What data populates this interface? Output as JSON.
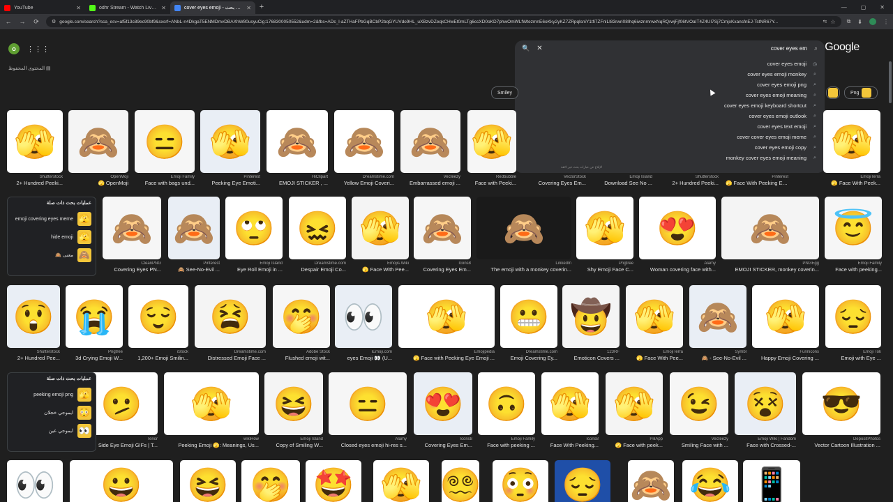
{
  "browser": {
    "tabs": [
      {
        "title": "YouTube",
        "color": "#ff0000"
      },
      {
        "title": "odhr Stream - Watch Live on Kick",
        "color": "#53fc18"
      },
      {
        "title": "cover eyes emoji - بحث Google",
        "color": "#4285f4"
      }
    ],
    "url": "google.com/search?sca_esv=af5f13c89ec90bf9&sxsrf=ANbL-n4DkgaT5ENMDmvDBAXhW80usyuCig:1768300050552&udm=2&fbs=ADc_l-aZTHaFPbGqBCbP2bqGYUVdo9HL_uXBzvDZeqkCHwEt0mLTg6ccXD0oKD7phwOmWLfWtezmnE6oKky2yKZ7ZRpqlsniY1tfi7ZFnlLI83rwri08Ihq6iwznmrwxNqRQrwjFjf06tVOaIT4Z4UI7Sj7CmjxKxansfnEJ-TstNR67Y..."
  },
  "header": {
    "avatar_letter": "o",
    "saved_text": "المحتوى المحفوظ",
    "logo_text": "Google"
  },
  "search": {
    "query": "cover eyes em",
    "suggestions": [
      "cover eyes emoji",
      "cover eyes emoji monkey",
      "cover eyes emoji png",
      "cover eyes emoji meaning",
      "cover eyes emoji keyboard shortcut",
      "cover eyes emoji outlook",
      "cover eyes text emoji",
      "cover cover eyes emoji meme",
      "cover eyes emoji copy",
      "monkey cover eyes emoji meaning"
    ],
    "note": "الإبلاغ عن عبارات بحث غير لائقة"
  },
  "chips": {
    "left": "Smiley",
    "right": "Png"
  },
  "related1": {
    "title": "عمليات بحث ذات صلة",
    "items": [
      {
        "label": "emoji covering eyes meme",
        "emoji": "🫣"
      },
      {
        "label": "hide emoji",
        "emoji": "🫣"
      },
      {
        "label": "🙈 معنى",
        "emoji": "🙈"
      }
    ]
  },
  "related2": {
    "title": "عمليات بحث ذات صلة",
    "items": [
      {
        "label": "peeking emoji png",
        "emoji": "🫣"
      },
      {
        "label": "ايموجي خجلان",
        "emoji": "😳"
      },
      {
        "label": "ايموجي عين",
        "emoji": "👀"
      }
    ]
  },
  "row1": [
    {
      "emoji": "🫣",
      "src": "Shutterstock",
      "cap": "2+ Hundred Peeki..."
    },
    {
      "emoji": "🙈",
      "src": "OpenMoji",
      "cap": "🫣 OpenMoji"
    },
    {
      "emoji": "😑",
      "src": "Emoji Family",
      "cap": "Face with bags und..."
    },
    {
      "emoji": "🫣",
      "src": "Pinterest",
      "cap": "Peeking Eye Emoti..."
    },
    {
      "emoji": "🙈",
      "src": "HiClipart",
      "cap": "EMOJI STICKER , ..."
    },
    {
      "emoji": "🙈",
      "src": "Dreamstime.com",
      "cap": "Yellow Emoji Coveri..."
    },
    {
      "emoji": "🙈",
      "src": "Vecteezy",
      "cap": "Embarrassed emoji ..."
    },
    {
      "emoji": "🫣",
      "src": "Redbubble",
      "cap": "Face with Peeki..."
    }
  ],
  "row1_right": [
    {
      "emoji": "🙈",
      "src": "VectorStock",
      "cap": "Covering Eyes Em..."
    },
    {
      "emoji": "🫣",
      "src": "Emoji Island",
      "cap": "Download See No ..."
    },
    {
      "emoji": "🫣",
      "src": "Shutterstock",
      "cap": "2+ Hundred Peeki..."
    },
    {
      "emoji": "🫣",
      "src": "Pinterest",
      "cap": "🫣 Face With Peeking Eye Emoji ..."
    },
    {
      "emoji": "🫣",
      "src": "EmojiTerra",
      "cap": "🫣 Face With Peek..."
    }
  ],
  "row2": [
    {
      "emoji": "🙈",
      "src": "CleanPNG",
      "cap": "Covering Eyes PN..."
    },
    {
      "emoji": "🙈",
      "src": "Pinterest",
      "cap": "🙈 See-No-Evil ..."
    },
    {
      "emoji": "🙄",
      "src": "Emoji Island",
      "cap": "Eye Roll Emoji in ..."
    },
    {
      "emoji": "😖",
      "src": "Dreamstime.com",
      "cap": "Despair Emoji Co..."
    },
    {
      "emoji": "🫣",
      "src": "Emojis.Wiki",
      "cap": "🫣 Face With Pee..."
    },
    {
      "emoji": "🙈",
      "src": "Icons8",
      "cap": "Covering Eyes Em..."
    },
    {
      "emoji": "🙈",
      "src": "LinkedIn",
      "cap": "The emoji with a monkey coverin..."
    },
    {
      "emoji": "🫣",
      "src": "Pngtree",
      "cap": "Shy Emoji Face C..."
    },
    {
      "emoji": "😍",
      "src": "Alamy",
      "cap": "Woman covering face with..."
    },
    {
      "emoji": "🙈",
      "src": "PNGEgg",
      "cap": "EMOJI STICKER, monkey coverin..."
    },
    {
      "emoji": "😇",
      "src": "Emoji Family",
      "cap": "Face with peeking..."
    }
  ],
  "row3": [
    {
      "emoji": "😲",
      "src": "Shutterstock",
      "cap": "2+ Hundred Pee..."
    },
    {
      "emoji": "😭",
      "src": "Pngtree",
      "cap": "3d Crying Emoji W..."
    },
    {
      "emoji": "😌",
      "src": "iStock",
      "cap": "1,200+ Emoji Smilin..."
    },
    {
      "emoji": "😫",
      "src": "Dreamstime.com",
      "cap": "Distressed Emoji Face ..."
    },
    {
      "emoji": "🤭",
      "src": "Adobe Stock",
      "cap": "Flushed emoji wit..."
    },
    {
      "emoji": "👀",
      "src": "iEmoji.com",
      "cap": "eyes Emoji 👀 (U..."
    },
    {
      "emoji": "🫣",
      "src": "Emojipedia",
      "cap": "🫣 Face with Peeking Eye Emoji ..."
    },
    {
      "emoji": "😬",
      "src": "Dreamstime.com",
      "cap": "Emoji Covering Ey..."
    },
    {
      "emoji": "🤠",
      "src": "123RF",
      "cap": "Emoticon Covers ..."
    },
    {
      "emoji": "🫣",
      "src": "EmojiTerra",
      "cap": "🫣 Face With Pee..."
    },
    {
      "emoji": "🙈",
      "src": "Symbl",
      "cap": "🙈 - See-No-Evil ..."
    },
    {
      "emoji": "🫣",
      "src": "Funnicons",
      "cap": "Happy Emoji Covering ..."
    },
    {
      "emoji": "😔",
      "src": "Emoji Tok",
      "cap": "Emoji with Eye ..."
    }
  ],
  "row4": [
    {
      "emoji": "🫤",
      "src": "Tenor",
      "cap": "Side Eye Emoji GIFs | T..."
    },
    {
      "emoji": "🫣",
      "src": "wikiHow",
      "cap": "Peeking Emoji 🫣: Meanings, Us..."
    },
    {
      "emoji": "😆",
      "src": "Emoji Island",
      "cap": "Copy of Smiling W..."
    },
    {
      "emoji": "😑",
      "src": "Alamy",
      "cap": "Closed eyes emoji hi-res s..."
    },
    {
      "emoji": "😍",
      "src": "Icons8",
      "cap": "Covering Eyes Em..."
    },
    {
      "emoji": "🙃",
      "src": "Emoji Family",
      "cap": "Face with peeking ..."
    },
    {
      "emoji": "🫣",
      "src": "Icons8",
      "cap": "Face With Peeking..."
    },
    {
      "emoji": "🫣",
      "src": "PiliApp",
      "cap": "🫣 Face with peek..."
    },
    {
      "emoji": "😉",
      "src": "Vecteezy",
      "cap": "Smiling Face with ..."
    },
    {
      "emoji": "😵",
      "src": "Emoji Wiki | Fandom",
      "cap": "Face with Crossed-..."
    },
    {
      "emoji": "😎",
      "src": "DepositPhotos",
      "cap": "Vector Cartoon Illustration ..."
    }
  ],
  "row5": [
    "👀",
    "😀",
    "😆",
    "🤭",
    "🤩",
    "🫣",
    "😵‍💫",
    "😳",
    "😔",
    "🙈",
    "😂",
    "📱"
  ]
}
